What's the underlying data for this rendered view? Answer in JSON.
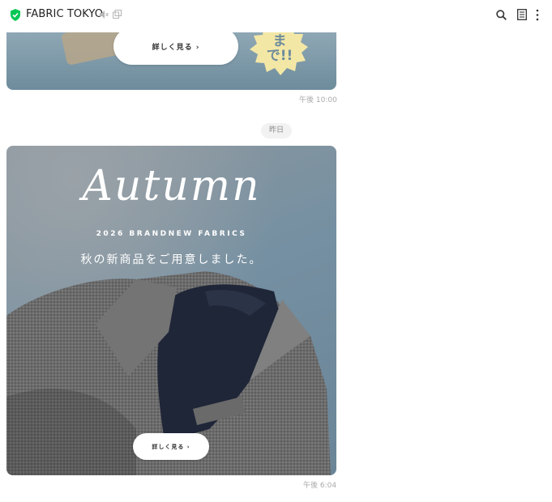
{
  "header": {
    "title": "FABRIC TOKYO",
    "icons": [
      "verified-shield-icon",
      "mute-speaker-icon",
      "copy-icon",
      "search-icon",
      "notes-icon",
      "more-vertical-icon"
    ],
    "accent_color": "#06c755"
  },
  "messages": [
    {
      "type": "image_banner",
      "button_label": "詳しく見る ›",
      "badge_text_line1": "",
      "badge_text_line2": "まで!!",
      "timestamp": "午後 10:00"
    },
    {
      "type": "date_separator",
      "label": "昨日"
    },
    {
      "type": "image_banner",
      "headline": "Autumn",
      "subheadline": "2026 BRANDNEW FABRICS",
      "caption": "秋の新商品をご用意しました。",
      "button_label": "詳しく見る ›",
      "timestamp": "午後 6:04"
    }
  ]
}
